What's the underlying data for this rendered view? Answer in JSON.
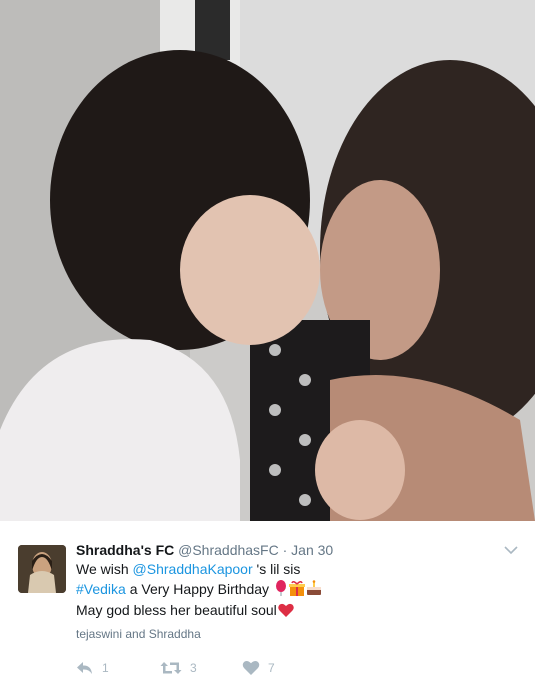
{
  "tweet": {
    "display_name": "Shraddha's FC",
    "handle": "@ShraddhasFC",
    "separator": "·",
    "date": "Jan 30",
    "text": {
      "line1_prefix": "We wish ",
      "mention": "@ShraddhaKapoor",
      "line1_suffix": " 's lil sis",
      "hashtag": "#Vedika",
      "line2_suffix": " a Very Happy Birthday",
      "line3": "May god bless her beautiful soul"
    },
    "liked_by": "tejaswini and Shraddha",
    "actions": {
      "reply_count": "1",
      "retweet_count": "3",
      "like_count": "7"
    }
  },
  "colors": {
    "link": "#1b95e0",
    "secondary_text": "#657786",
    "action_icon": "#aab8c2",
    "heart_emoji": "#e0245e"
  },
  "icons": [
    "caret-down-icon",
    "reply-icon",
    "retweet-icon",
    "heart-icon",
    "balloon-emoji",
    "gift-emoji",
    "cake-emoji",
    "red-heart-emoji"
  ]
}
